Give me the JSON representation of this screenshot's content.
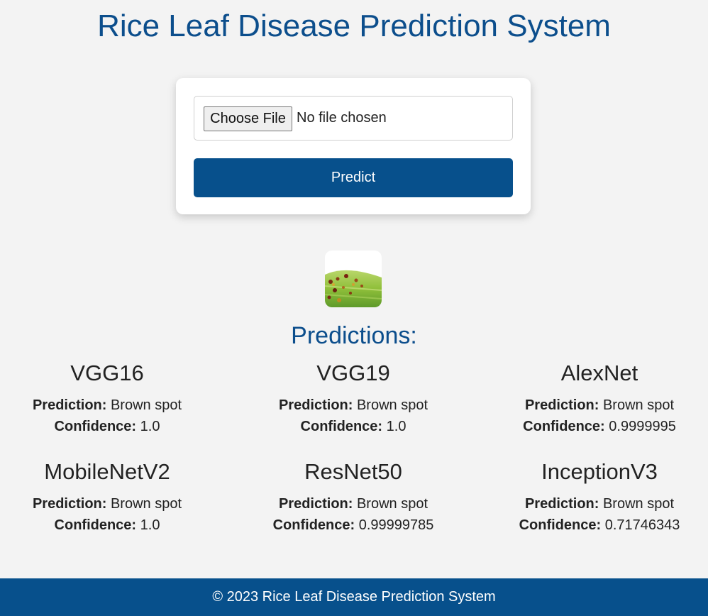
{
  "page": {
    "title": "Rice Leaf Disease Prediction System"
  },
  "upload": {
    "choose_file_label": "Choose File",
    "file_status": "No file chosen",
    "predict_label": "Predict"
  },
  "predictions": {
    "heading": "Predictions:",
    "prediction_label": "Prediction:",
    "confidence_label": "Confidence:",
    "models": [
      {
        "name": "VGG16",
        "prediction": "Brown spot",
        "confidence": "1.0"
      },
      {
        "name": "VGG19",
        "prediction": "Brown spot",
        "confidence": "1.0"
      },
      {
        "name": "AlexNet",
        "prediction": "Brown spot",
        "confidence": "0.9999995"
      },
      {
        "name": "MobileNetV2",
        "prediction": "Brown spot",
        "confidence": "1.0"
      },
      {
        "name": "ResNet50",
        "prediction": "Brown spot",
        "confidence": "0.99999785"
      },
      {
        "name": "InceptionV3",
        "prediction": "Brown spot",
        "confidence": "0.71746343"
      }
    ]
  },
  "footer": {
    "text": "© 2023 Rice Leaf Disease Prediction System"
  },
  "colors": {
    "brand": "#07508c",
    "title": "#0c4e8c",
    "background": "#f3f3f3"
  }
}
